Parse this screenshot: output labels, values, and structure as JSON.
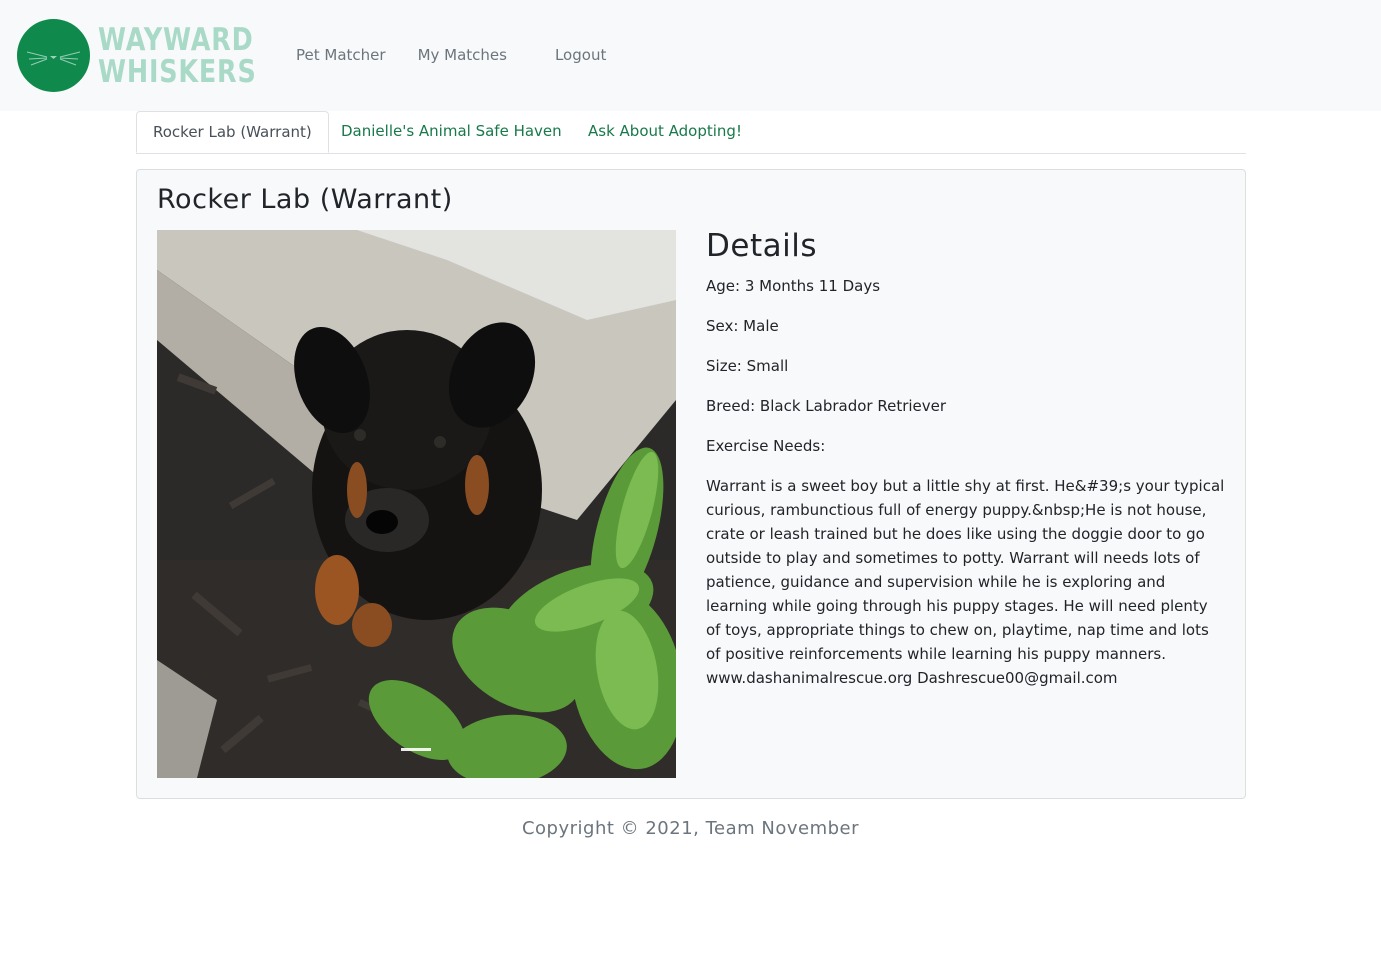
{
  "brand": {
    "line1": "WAYWARD",
    "line2": "WHISKERS",
    "circle_color": "#0f8a4c",
    "text_color": "#a9d9c7"
  },
  "nav": {
    "items": [
      "Pet Matcher",
      "My Matches",
      "Logout"
    ]
  },
  "tabs": [
    {
      "label": "Rocker Lab (Warrant)",
      "active": true
    },
    {
      "label": "Danielle's Animal Safe Haven",
      "active": false
    },
    {
      "label": "Ask About Adopting!",
      "active": false
    }
  ],
  "pet": {
    "name": "Rocker Lab (Warrant)",
    "details_heading": "Details",
    "age": "Age: 3 Months 11 Days",
    "sex": "Sex: Male",
    "size": "Size: Small",
    "breed": "Breed: Black Labrador Retriever",
    "exercise": "Exercise Needs:",
    "description": "Warrant is a sweet boy but a little shy at first. He&#39;s your typical curious, rambunctious full of energy puppy.&nbsp;He is not house, crate or leash trained but he does like using the doggie door to go outside to play and sometimes to potty. Warrant will needs lots of patience, guidance and supervision while he is exploring and learning while going through his puppy stages. He will need plenty of toys, appropriate things to chew on, playtime, nap time and lots of positive reinforcements while learning his puppy manners. www.dashanimalrescue.org Dashrescue00@gmail.com"
  },
  "footer": {
    "text": "Copyright © 2021, Team November"
  },
  "colors": {
    "accent_green": "#18794a",
    "nav_gray": "#6c757d",
    "background_light": "#f8f9fa"
  }
}
